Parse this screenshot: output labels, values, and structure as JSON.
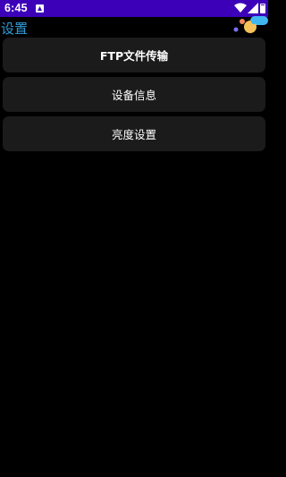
{
  "status_bar": {
    "time": "6:45",
    "background": "#3b00b8",
    "icons": [
      "notification-icon",
      "wifi-icon",
      "signal-icon",
      "battery-icon"
    ]
  },
  "header": {
    "title": "设置",
    "title_color": "#2f9bd9"
  },
  "menu": {
    "items": [
      {
        "label": "FTP文件传输"
      },
      {
        "label": "设备信息"
      },
      {
        "label": "亮度设置"
      }
    ],
    "item_background": "#1b1b1b"
  }
}
